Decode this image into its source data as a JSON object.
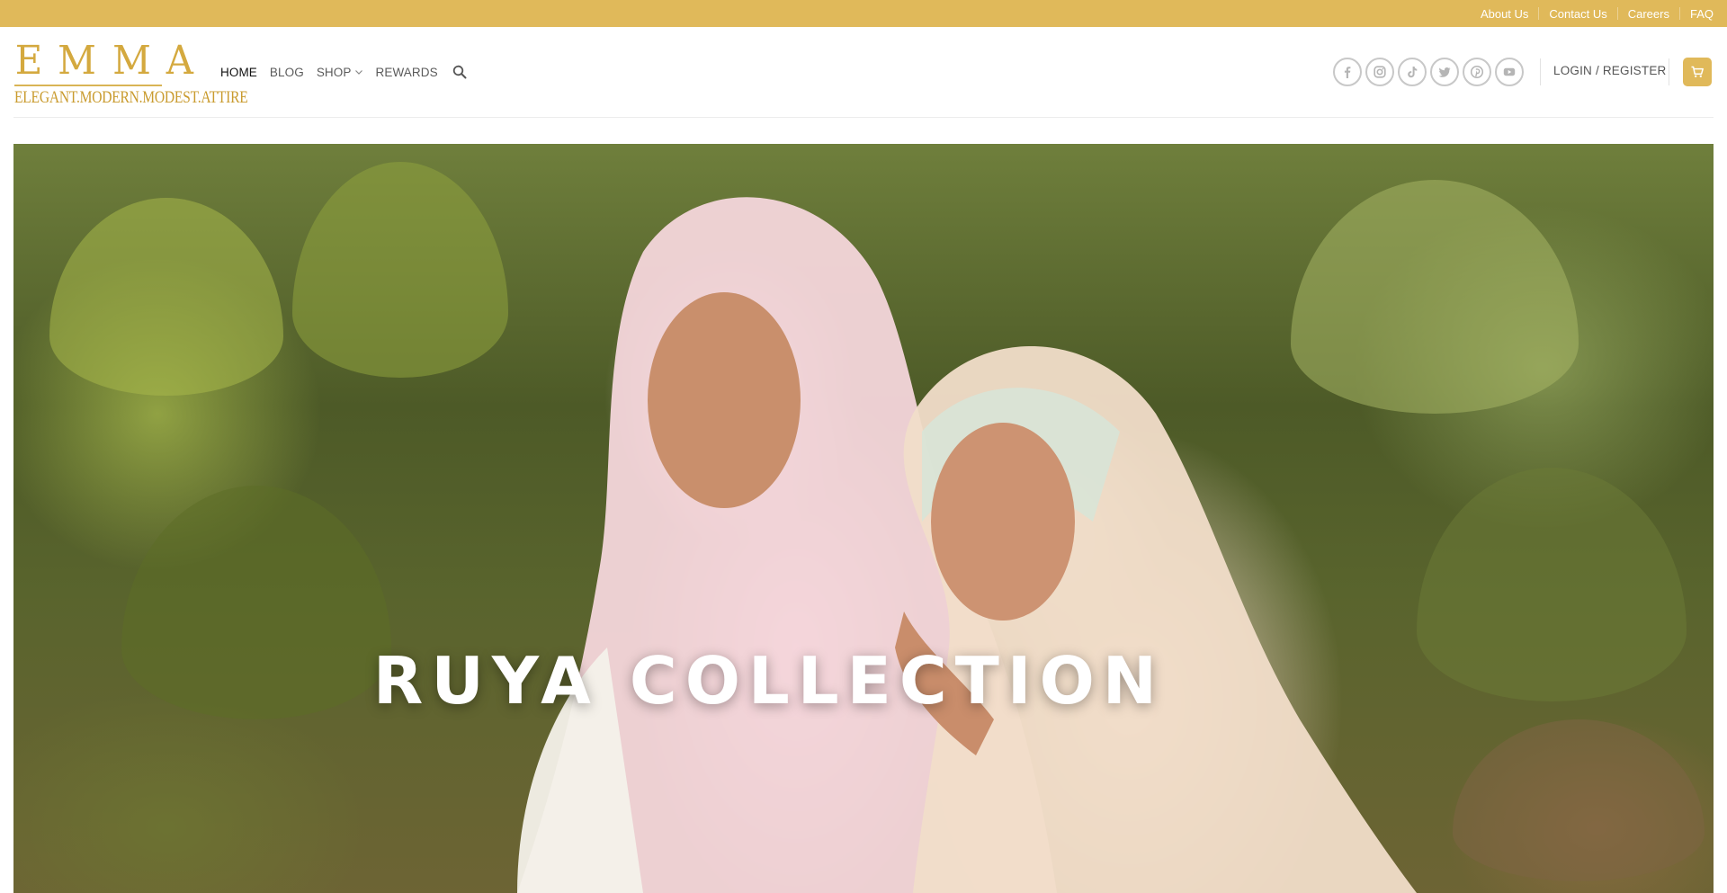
{
  "topbar": {
    "background": "#e0b95a",
    "links": [
      "About Us",
      "Contact Us",
      "Careers",
      "FAQ"
    ]
  },
  "logo": {
    "letters": [
      "E",
      "M",
      "M",
      "A"
    ],
    "tagline": "ELEGANT.MODERN.MODEST.ATTIRE"
  },
  "nav": {
    "items": [
      "HOME",
      "BLOG",
      "SHOP",
      "REWARDS"
    ],
    "active": "HOME"
  },
  "icons": {
    "search": "search-icon",
    "socials": [
      "facebook-icon",
      "instagram-icon",
      "tiktok-icon",
      "twitter-icon",
      "pinterest-icon",
      "youtube-icon"
    ],
    "cart": "cart-icon"
  },
  "account": {
    "login_label": "LOGIN / REGISTER"
  },
  "hero": {
    "title": "RUYA COLLECTION"
  },
  "colors": {
    "accent": "#e0b95a",
    "logo_gold": "#d4a93f"
  }
}
